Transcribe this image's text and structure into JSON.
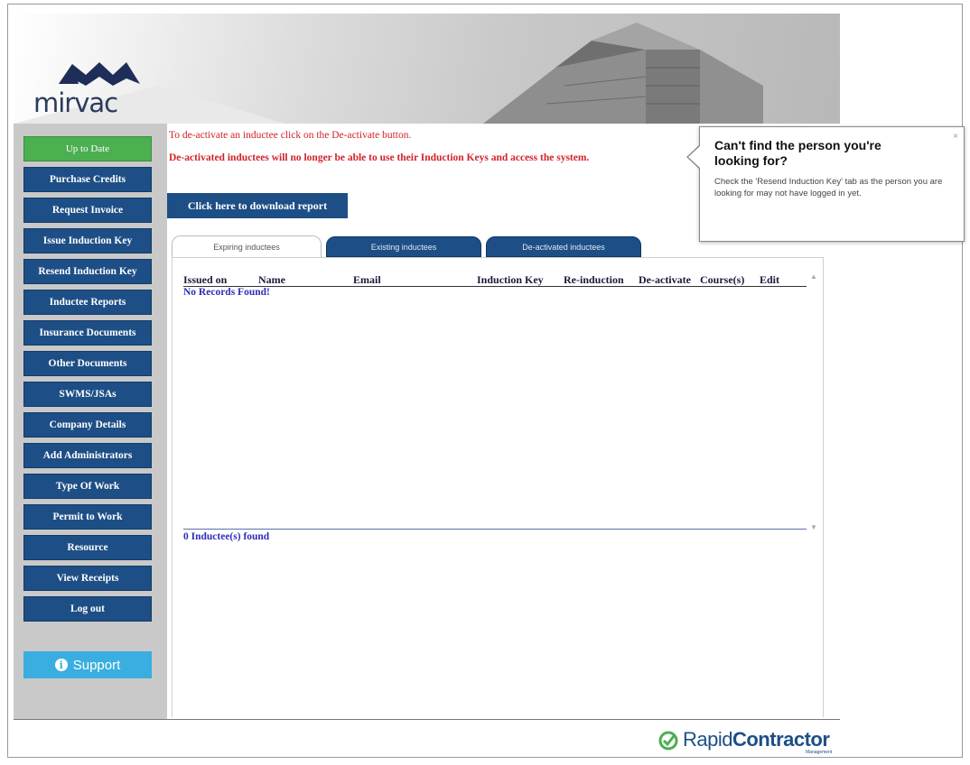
{
  "brand": {
    "logo_text": "mirvac",
    "footer_light": "Rapid",
    "footer_bold": "Contractor",
    "footer_sub": "Management"
  },
  "sidebar": {
    "items": [
      {
        "label": "Up to Date",
        "style": "green"
      },
      {
        "label": "Purchase Credits"
      },
      {
        "label": "Request Invoice"
      },
      {
        "label": "Issue Induction Key"
      },
      {
        "label": "Resend Induction Key"
      },
      {
        "label": "Inductee Reports"
      },
      {
        "label": "Insurance Documents"
      },
      {
        "label": "Other Documents"
      },
      {
        "label": "SWMS/JSAs"
      },
      {
        "label": "Company Details"
      },
      {
        "label": "Add Administrators"
      },
      {
        "label": "Type Of Work"
      },
      {
        "label": "Permit to Work"
      },
      {
        "label": "Resource"
      },
      {
        "label": "View Receipts"
      },
      {
        "label": "Log out"
      }
    ],
    "support_label": "Support"
  },
  "main": {
    "notice_1": "To de-activate an inductee click on the De-activate button.",
    "notice_2": "De-activated inductees will no longer be able to use their Induction Keys and access the system.",
    "download_label": "Click here to download report",
    "tabs": [
      {
        "label": "Expiring inductees",
        "active": true
      },
      {
        "label": "Existing inductees",
        "active": false
      },
      {
        "label": "De-activated inductees",
        "active": false
      }
    ],
    "table": {
      "columns": [
        "Issued on",
        "Name",
        "Email",
        "Induction Key",
        "Re-induction",
        "De-activate",
        "Course(s)",
        "Edit"
      ],
      "empty_text": "No Records Found!",
      "footer_text": "0 Inductee(s) found"
    }
  },
  "popup": {
    "title": "Can't find the person you're looking for?",
    "text": "Check the 'Resend Induction Key' tab as the person you are looking for may not have logged in yet.",
    "close": "×"
  },
  "colors": {
    "nav": "#1d4f86",
    "green": "#4caf50",
    "notice": "#d2232a",
    "support": "#3aaee0",
    "record_text": "#2d2db8"
  }
}
